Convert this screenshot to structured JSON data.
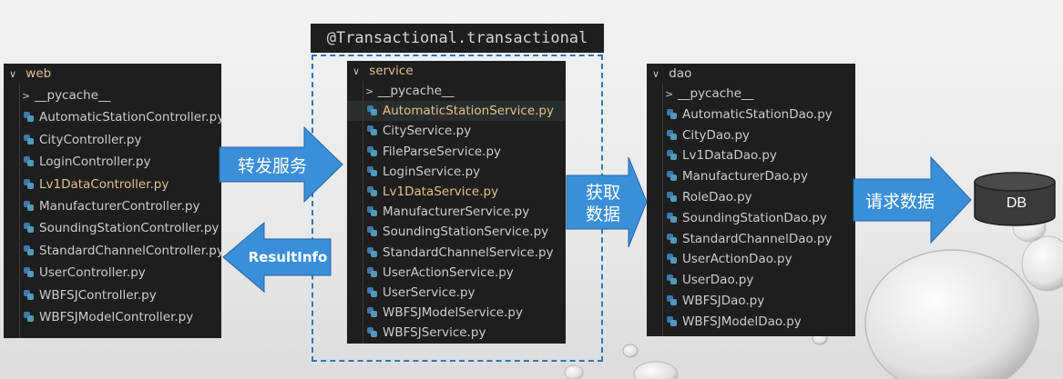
{
  "transactional_label": "@Transactional.transactional",
  "arrows": {
    "forward": "转发服务",
    "result": "ResultInfo",
    "fetch_line1": "获取",
    "fetch_line2": "数据",
    "request": "请求数据"
  },
  "db_label": "DB",
  "web": {
    "folder": "web",
    "items": [
      {
        "name": "__pycache__",
        "kind": "folder"
      },
      {
        "name": "AutomaticStationController.py",
        "kind": "py"
      },
      {
        "name": "CityController.py",
        "kind": "py"
      },
      {
        "name": "LoginController.py",
        "kind": "py"
      },
      {
        "name": "Lv1DataController.py",
        "kind": "py",
        "modified": true
      },
      {
        "name": "ManufacturerController.py",
        "kind": "py"
      },
      {
        "name": "SoundingStationController.py",
        "kind": "py"
      },
      {
        "name": "StandardChannelController.py",
        "kind": "py"
      },
      {
        "name": "UserController.py",
        "kind": "py"
      },
      {
        "name": "WBFSJController.py",
        "kind": "py"
      },
      {
        "name": "WBFSJModelController.py",
        "kind": "py"
      }
    ]
  },
  "service": {
    "folder": "service",
    "items": [
      {
        "name": "__pycache__",
        "kind": "folder"
      },
      {
        "name": "AutomaticStationService.py",
        "kind": "py",
        "modified": true,
        "selected": true
      },
      {
        "name": "CityService.py",
        "kind": "py"
      },
      {
        "name": "FileParseService.py",
        "kind": "py"
      },
      {
        "name": "LoginService.py",
        "kind": "py"
      },
      {
        "name": "Lv1DataService.py",
        "kind": "py",
        "modified": true
      },
      {
        "name": "ManufacturerService.py",
        "kind": "py"
      },
      {
        "name": "SoundingStationService.py",
        "kind": "py"
      },
      {
        "name": "StandardChannelService.py",
        "kind": "py"
      },
      {
        "name": "UserActionService.py",
        "kind": "py"
      },
      {
        "name": "UserService.py",
        "kind": "py"
      },
      {
        "name": "WBFSJModelService.py",
        "kind": "py"
      },
      {
        "name": "WBFSJService.py",
        "kind": "py"
      }
    ]
  },
  "dao": {
    "folder": "dao",
    "items": [
      {
        "name": "__pycache__",
        "kind": "folder"
      },
      {
        "name": "AutomaticStationDao.py",
        "kind": "py"
      },
      {
        "name": "CityDao.py",
        "kind": "py"
      },
      {
        "name": "Lv1DataDao.py",
        "kind": "py"
      },
      {
        "name": "ManufacturerDao.py",
        "kind": "py"
      },
      {
        "name": "RoleDao.py",
        "kind": "py"
      },
      {
        "name": "SoundingStationDao.py",
        "kind": "py"
      },
      {
        "name": "StandardChannelDao.py",
        "kind": "py"
      },
      {
        "name": "UserActionDao.py",
        "kind": "py"
      },
      {
        "name": "UserDao.py",
        "kind": "py"
      },
      {
        "name": "WBFSJDao.py",
        "kind": "py"
      },
      {
        "name": "WBFSJModelDao.py",
        "kind": "py"
      }
    ]
  },
  "colors": {
    "arrow_fill": "#3a8fd8",
    "arrow_stroke": "#2167a8",
    "modified_text": "#e2c08d",
    "db_fill": "#3a3a3a"
  }
}
